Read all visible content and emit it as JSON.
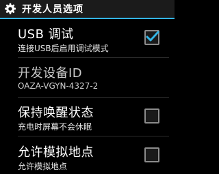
{
  "header": {
    "title": "开发人员选项",
    "icon": "gear-icon",
    "accent_color": "#33b5e5"
  },
  "rows": [
    {
      "title": "USB 调试",
      "subtitle": "连接USB后启用调试模式",
      "checked": true
    },
    {
      "title": "开发设备ID",
      "subtitle": "OAZA-VGYN-4327-2"
    },
    {
      "title": "保持唤醒状态",
      "subtitle": "充电时屏幕不会休眠",
      "checked": false
    },
    {
      "title": "允许模拟地点",
      "subtitle": "允许模拟地点",
      "checked": false
    }
  ]
}
